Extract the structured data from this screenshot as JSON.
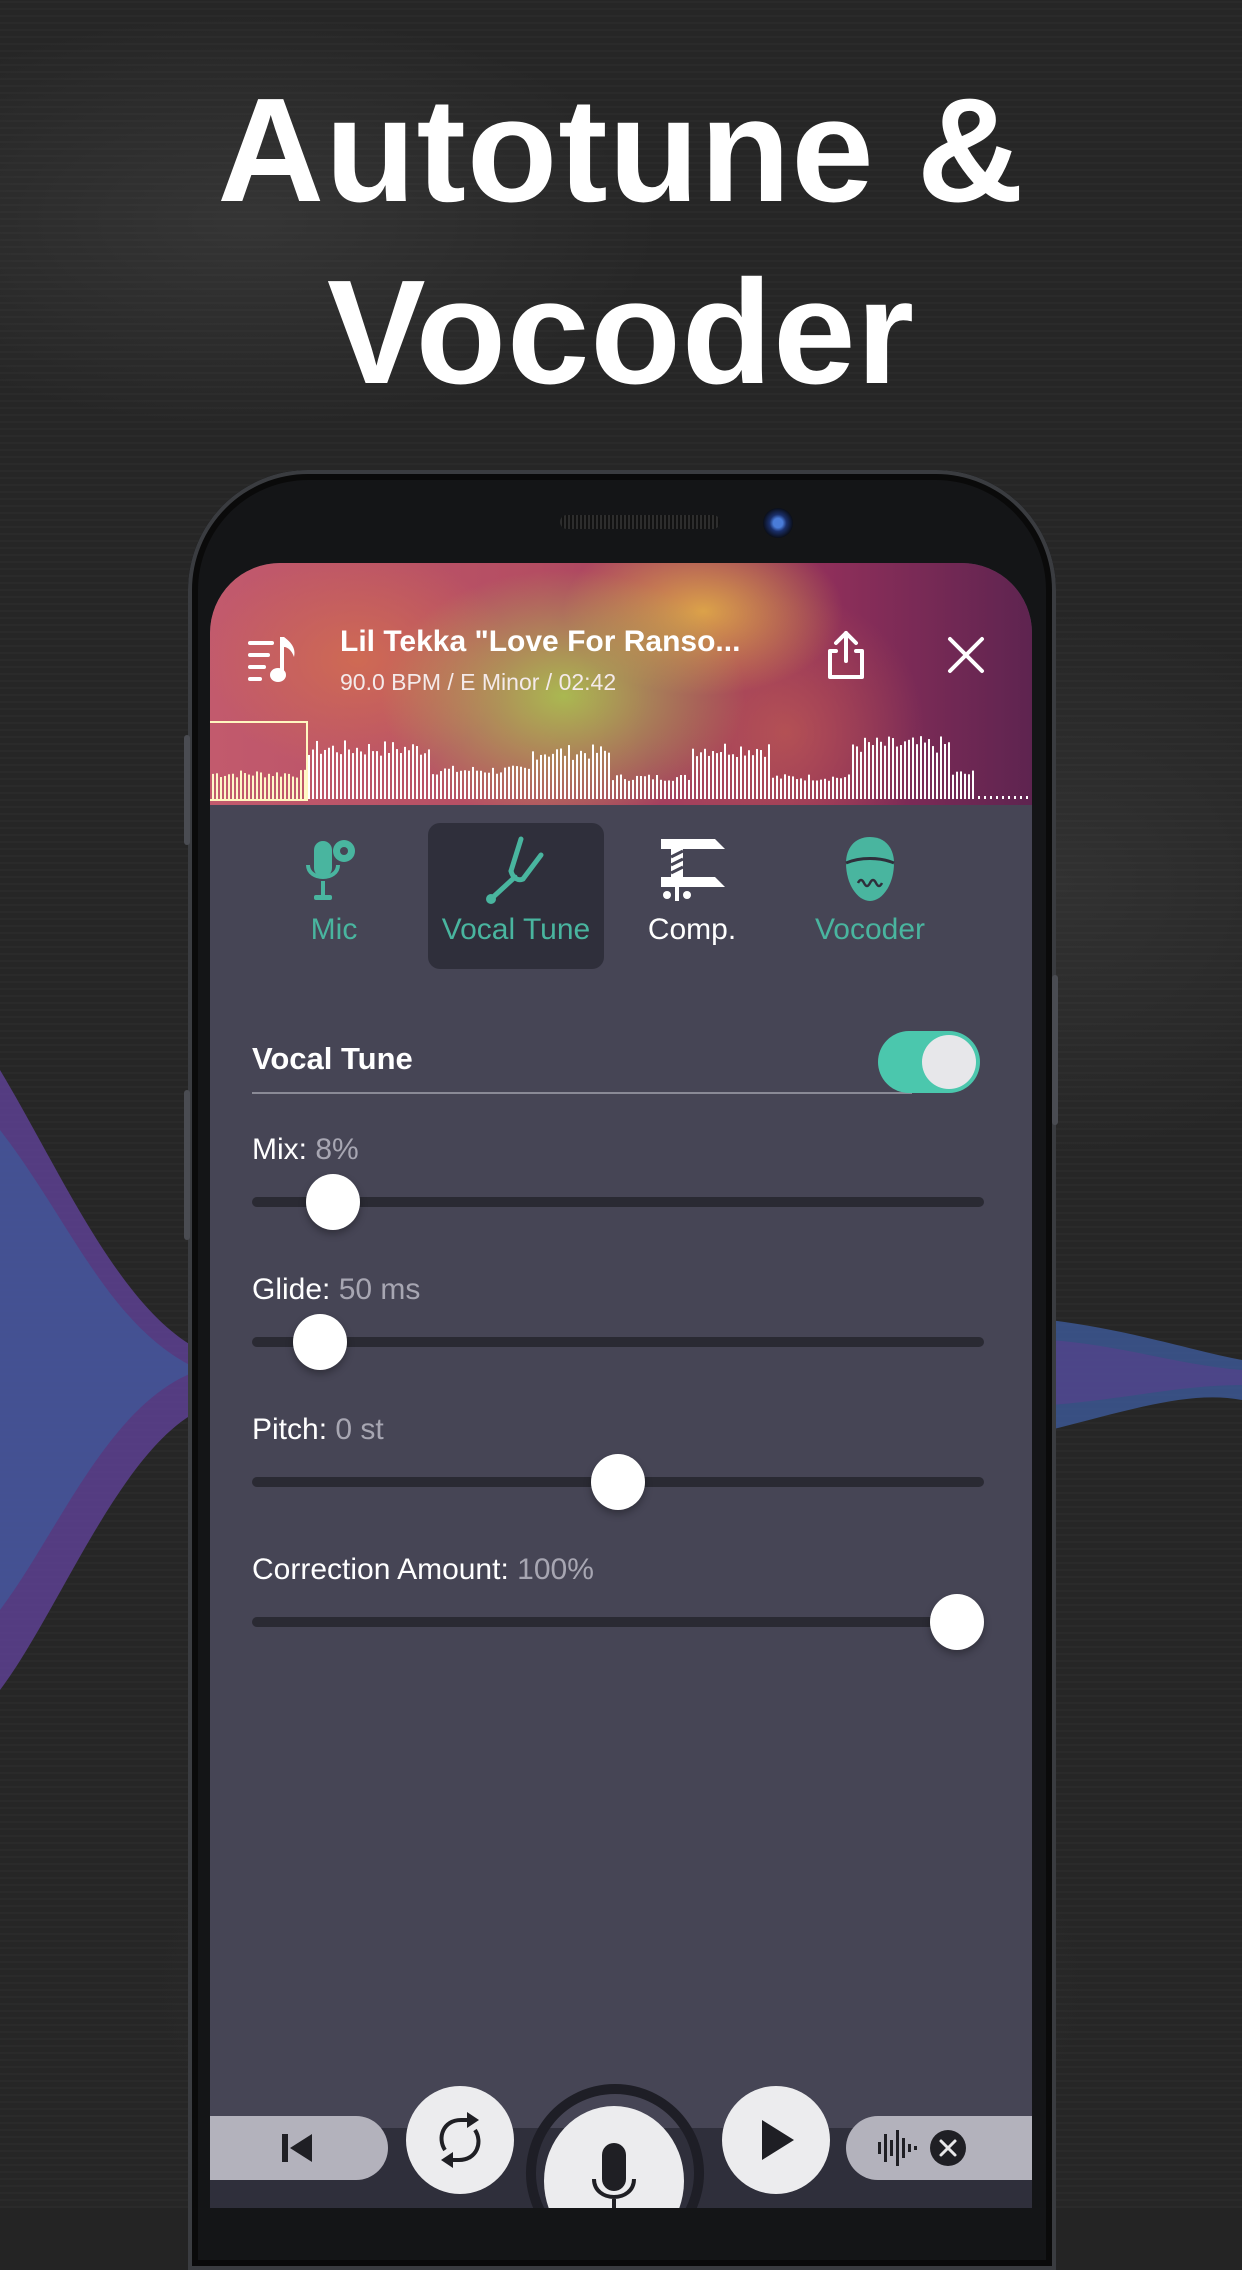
{
  "headline": {
    "line1": "Autotune &",
    "line2": "Vocoder"
  },
  "colors": {
    "accent": "#4bc7ad",
    "tab_active_text": "#49b59f",
    "panel_bg": "#464555",
    "track": "#2a2a33"
  },
  "header": {
    "title": "Lil Tekka \"Love For Ranso...",
    "meta": "90.0 BPM / E Minor / 02:42",
    "icons": {
      "playlist": "playlist-music-icon",
      "share": "share-icon",
      "close": "close-icon"
    }
  },
  "tabs": [
    {
      "label": "Mic",
      "icon": "mic-settings-icon",
      "active": false
    },
    {
      "label": "Vocal Tune",
      "icon": "tuning-fork-icon",
      "active": true
    },
    {
      "label": "Comp.",
      "icon": "clamp-icon",
      "active": false
    },
    {
      "label": "Vocoder",
      "icon": "robot-head-icon",
      "active": false
    }
  ],
  "section": {
    "title": "Vocal Tune",
    "enabled": true
  },
  "params": [
    {
      "label": "Mix:",
      "value": "8%",
      "fraction": 0.08
    },
    {
      "label": "Glide:",
      "value": "50 ms",
      "fraction": 0.06
    },
    {
      "label": "Pitch:",
      "value": "0 st",
      "fraction": 0.5
    },
    {
      "label": "Correction Amount:",
      "value": "100%",
      "fraction": 1.0
    }
  ],
  "transport": {
    "skip_back": "skip-back-icon",
    "loop": "loop-icon",
    "record": "microphone-icon",
    "play": "play-icon",
    "clear_recording": "waveform-clear-icon",
    "record_level": 0.05
  }
}
